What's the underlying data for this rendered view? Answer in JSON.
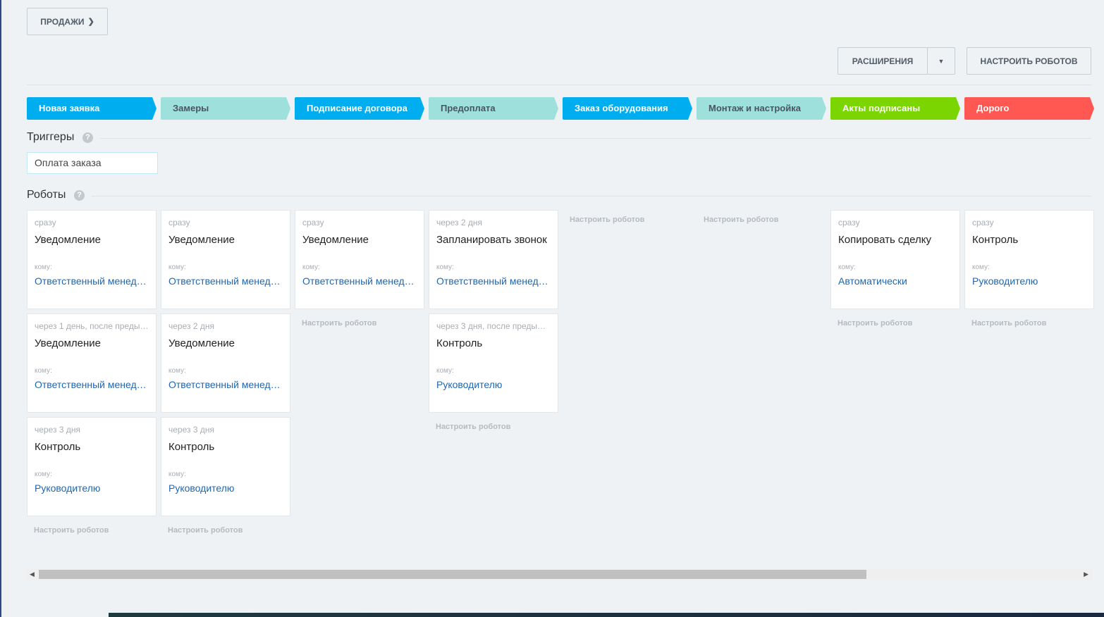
{
  "header": {
    "category": "ПРОДАЖИ",
    "extensions": "РАСШИРЕНИЯ",
    "configure": "НАСТРОИТЬ РОБОТОВ"
  },
  "stages": [
    {
      "label": "Новая заявка",
      "color": "#00aeef",
      "text": "#ffffff"
    },
    {
      "label": "Замеры",
      "color": "#9de0dc",
      "text": "#4a5560"
    },
    {
      "label": "Подписание договора",
      "color": "#00aeef",
      "text": "#ffffff"
    },
    {
      "label": "Предоплата",
      "color": "#9de0dc",
      "text": "#4a5560"
    },
    {
      "label": "Заказ оборудования",
      "color": "#00aeef",
      "text": "#ffffff"
    },
    {
      "label": "Монтаж и настройка",
      "color": "#9de0dc",
      "text": "#4a5560"
    },
    {
      "label": "Акты подписаны",
      "color": "#7bd500",
      "text": "#ffffff"
    },
    {
      "label": "Дорого",
      "color": "#ff5752",
      "text": "#ffffff"
    }
  ],
  "triggers": {
    "title": "Триггеры",
    "help": "?",
    "items": [
      "Оплата заказа"
    ]
  },
  "robots": {
    "title": "Роботы",
    "help": "?",
    "komu": "кому:",
    "configure_link": "Настроить роботов",
    "columns": [
      [
        {
          "when": "сразу",
          "title": "Уведомление",
          "who": "Ответственный менеджер"
        },
        {
          "when": "через 1 день, после предыдущего",
          "title": "Уведомление",
          "who": "Ответственный менеджер"
        },
        {
          "when": "через 3 дня",
          "title": "Контроль",
          "who": "Руководителю"
        }
      ],
      [
        {
          "when": "сразу",
          "title": "Уведомление",
          "who": "Ответственный менеджер"
        },
        {
          "when": "через 2 дня",
          "title": "Уведомление",
          "who": "Ответственный менеджер"
        },
        {
          "when": "через 3 дня",
          "title": "Контроль",
          "who": "Руководителю"
        }
      ],
      [
        {
          "when": "сразу",
          "title": "Уведомление",
          "who": "Ответственный менеджер"
        }
      ],
      [
        {
          "when": "через 2 дня",
          "title": "Запланировать звонок",
          "who": "Ответственный менеджер"
        },
        {
          "when": "через 3 дня, после предыдущего",
          "title": "Контроль",
          "who": "Руководителю"
        }
      ],
      [],
      [],
      [
        {
          "when": "сразу",
          "title": "Копировать сделку",
          "who": "Автоматически"
        }
      ],
      [
        {
          "when": "сразу",
          "title": "Контроль",
          "who": "Руководителю"
        }
      ]
    ]
  }
}
